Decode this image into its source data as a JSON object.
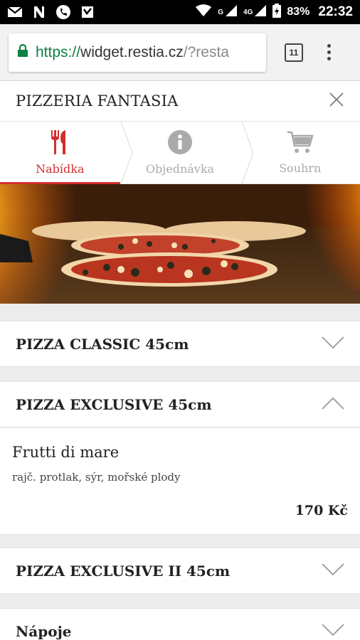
{
  "status_bar": {
    "left_icons": [
      "gmail-icon",
      "n-app-icon",
      "phone-icon",
      "app-icon"
    ],
    "network_g": "G",
    "network_4g": "4G",
    "battery": "83%",
    "time": "22:32"
  },
  "browser": {
    "url_scheme": "https://",
    "url_host": "widget.restia.cz",
    "url_rest": "/?resta",
    "tab_count": "11"
  },
  "widget": {
    "title": "PIZZERIA FANTASIA"
  },
  "steps": [
    {
      "label": "Nabídka",
      "icon": "cutlery-icon",
      "active": true
    },
    {
      "label": "Objednávka",
      "icon": "info-icon",
      "active": false
    },
    {
      "label": "Souhrn",
      "icon": "cart-icon",
      "active": false
    }
  ],
  "sections": [
    {
      "title": "PIZZA CLASSIC 45cm",
      "expanded": false
    },
    {
      "title": "PIZZA EXCLUSIVE 45cm",
      "expanded": true
    },
    {
      "title": "PIZZA EXCLUSIVE II 45cm",
      "expanded": false
    },
    {
      "title": "Nápoje",
      "expanded": false
    }
  ],
  "items": [
    {
      "name": "Frutti di mare",
      "description": "rajč. protlak, sýr, mořské plody",
      "price": "170 Kč"
    }
  ],
  "colors": {
    "accent": "#d32f2f",
    "inactive": "#aaaaaa",
    "url_green": "#0b8043"
  }
}
